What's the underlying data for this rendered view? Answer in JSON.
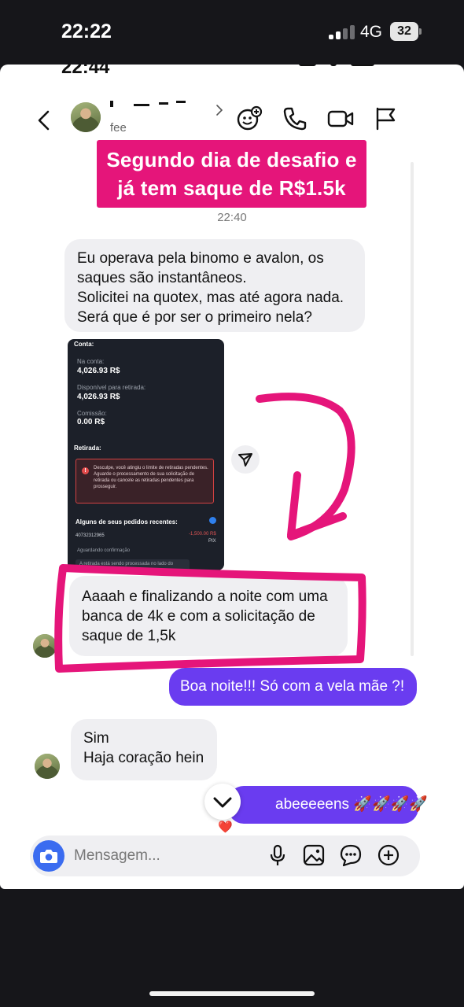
{
  "status_bar": {
    "time": "22:22",
    "network": "4G",
    "battery": "32"
  },
  "background_status": {
    "time": "22:44"
  },
  "chat_header": {
    "contact_subtitle": "fee"
  },
  "overlay_caption": {
    "line1": "Segundo dia de desafio e",
    "line2": "já tem saque de R$1.5k"
  },
  "timestamp": "22:40",
  "messages": [
    {
      "side": "in",
      "lines": [
        "Eu operava pela binomo e avalon, os",
        "saques são instantâneos.",
        "Solicitei na quotex, mas até agora nada.",
        "Será que é por ser o primeiro nela?"
      ]
    },
    {
      "side": "in",
      "lines": [
        "Aaaah e finalizando a noite com uma",
        "banca de 4k e com a solicitação de",
        "saque de 1,5k"
      ]
    },
    {
      "side": "out",
      "text": "Boa noite!!! Só com a vela mãe ?!"
    },
    {
      "side": "in",
      "lines": [
        "Sim",
        "Haja coração hein"
      ]
    },
    {
      "side": "out",
      "text": "abeeeeens 🚀🚀🚀🚀"
    }
  ],
  "screenshot": {
    "account_label": "Conta:",
    "balance_label": "Na conta:",
    "balance_value": "4,026.93 R$",
    "available_label": "Disponível para retirada:",
    "available_value": "4,026.93 R$",
    "commission_label": "Comissão:",
    "commission_value": "0.00 R$",
    "withdrawal_label": "Retirada:",
    "error_text": "Desculpe, você atingiu o limite de retiradas pendentes. Aguarde o processamento de sua solicitação de retirada ou cancele as retiradas pendentes para prosseguir.",
    "recent_title": "Alguns de seus pedidos recentes:",
    "order_id": "40732312965",
    "order_amount": "-1,500.00 R$",
    "order_method": "PIX",
    "order_status": "Aguardando confirmação",
    "order_note": "A retirada está sendo processada no lado do"
  },
  "reaction": "❤️",
  "composer": {
    "placeholder": "Mensagem..."
  },
  "colors": {
    "caption_bg": "#e5157a",
    "outgoing_bubble": "#6a3cf0",
    "annotation": "#e5157a",
    "camera_button": "#3b6cf0"
  },
  "icons": [
    "back-arrow-icon",
    "chevron-right-icon",
    "sticker-add-icon",
    "phone-icon",
    "video-icon",
    "flag-icon",
    "share-icon",
    "chevron-down-icon",
    "camera-icon",
    "microphone-icon",
    "gallery-icon",
    "sticker-icon",
    "plus-circle-icon"
  ]
}
